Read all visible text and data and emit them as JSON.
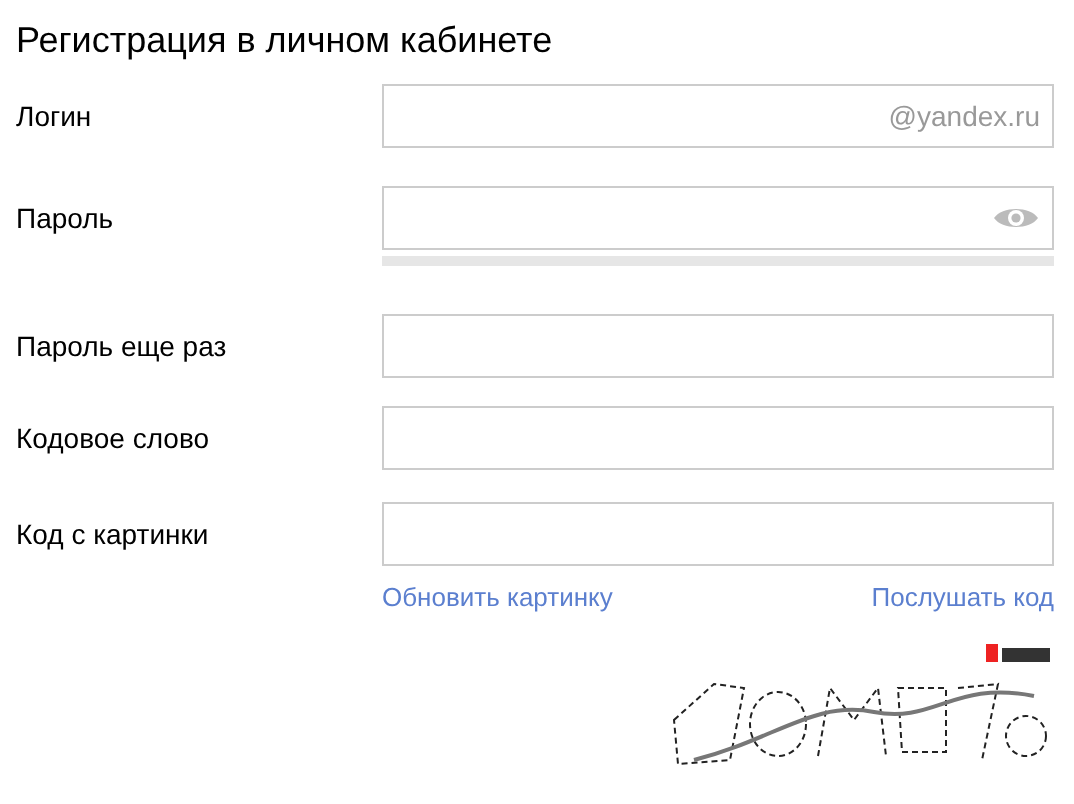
{
  "title": "Регистрация в личном кабинете",
  "fields": [
    {
      "label": "Логин",
      "kind": "suffix",
      "suffix": "@yandex.ru"
    },
    {
      "label": "Пароль",
      "kind": "password",
      "strength": {
        "level": 0
      }
    },
    {
      "label": "Пароль еще раз",
      "kind": "text"
    },
    {
      "label": "Кодовое слово",
      "kind": "text"
    },
    {
      "label": "Код с картинки",
      "kind": "text"
    }
  ],
  "captcha_links": [
    "Обновить картинку",
    "Послушать код"
  ]
}
